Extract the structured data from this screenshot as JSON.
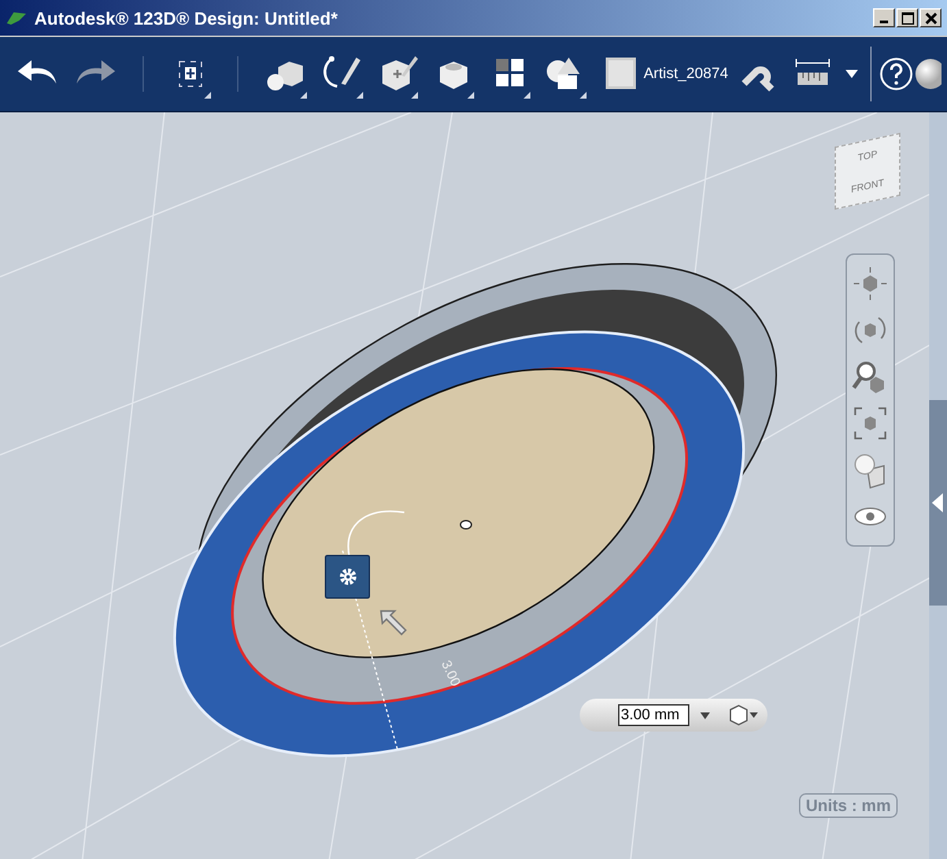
{
  "window": {
    "title": "Autodesk® 123D® Design: Untitled*"
  },
  "toolbar": {
    "tools": [
      {
        "kind": "undo",
        "menu": false
      },
      {
        "kind": "redo",
        "menu": false
      },
      {
        "kind": "transform",
        "menu": true
      },
      {
        "kind": "primitives",
        "menu": true
      },
      {
        "kind": "sketch",
        "menu": true
      },
      {
        "kind": "construct",
        "menu": true
      },
      {
        "kind": "modify",
        "menu": true
      },
      {
        "kind": "pattern",
        "menu": true
      },
      {
        "kind": "combine",
        "menu": true
      },
      {
        "kind": "material",
        "menu": false
      }
    ],
    "user": "Artist_20874",
    "after_user": [
      {
        "kind": "magnet"
      },
      {
        "kind": "measure"
      },
      {
        "kind": "caret"
      }
    ]
  },
  "view_cube": {
    "top": "TOP",
    "front": "FRONT"
  },
  "nav_bar": [
    {
      "kind": "pan"
    },
    {
      "kind": "orbit"
    },
    {
      "kind": "zoom"
    },
    {
      "kind": "fit"
    },
    {
      "kind": "visual"
    },
    {
      "kind": "eye"
    }
  ],
  "model": {
    "dimension_label": "3.00"
  },
  "dimension_input": {
    "value": "3.00 mm"
  },
  "units_badge": "Units : mm"
}
